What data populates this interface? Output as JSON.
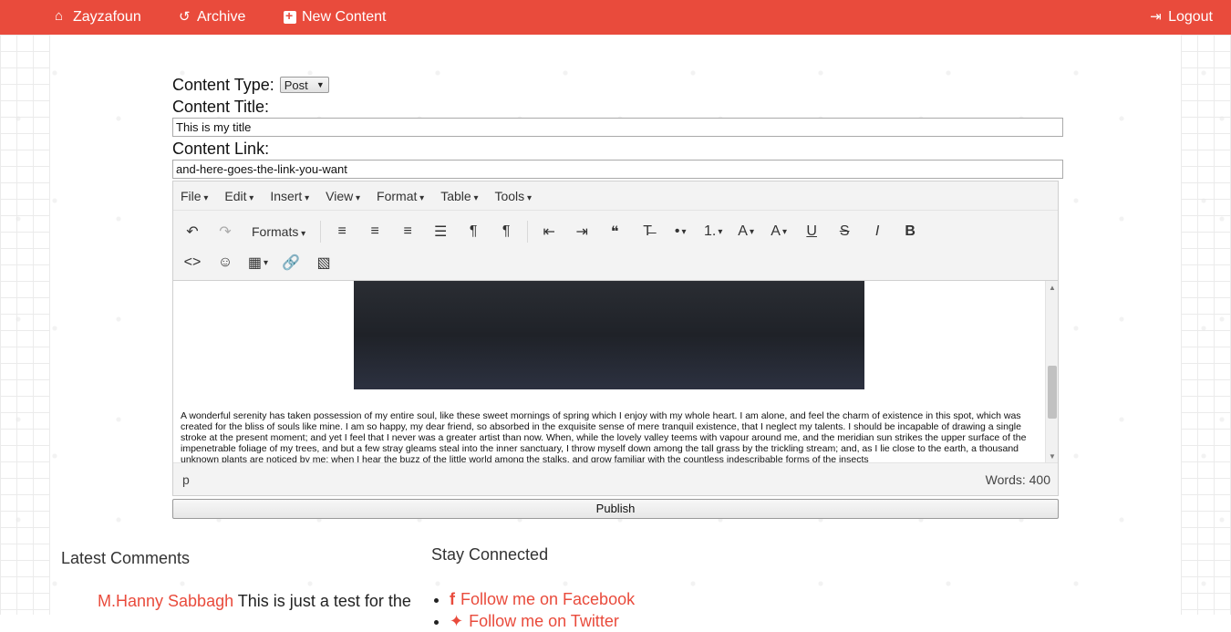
{
  "nav": {
    "items": [
      {
        "label": "Zayzafoun"
      },
      {
        "label": "Archive"
      },
      {
        "label": "New Content"
      }
    ],
    "logout_label": "Logout",
    "bg_color": "#e94b3c"
  },
  "form": {
    "content_type_label": "Content Type:",
    "content_type_value": "Post",
    "content_title_label": "Content Title:",
    "content_title_value": "This is my title",
    "content_link_label": "Content Link:",
    "content_link_value": "and-here-goes-the-link-you-want"
  },
  "editor": {
    "menus": [
      "File",
      "Edit",
      "Insert",
      "View",
      "Format",
      "Table",
      "Tools"
    ],
    "formats_label": "Formats",
    "paragraph_text": "A wonderful serenity has taken possession of my entire soul, like these sweet mornings of spring which I enjoy with my whole heart. I am alone, and feel the charm of existence in this spot, which was created for the bliss of souls like mine. I am so happy, my dear friend, so absorbed in the exquisite sense of mere tranquil existence, that I neglect my talents. I should be incapable of drawing a single stroke at the present moment; and yet I feel that I never was a greater artist than now. When, while the lovely valley teems with vapour around me, and the meridian sun strikes the upper surface of the impenetrable foliage of my trees, and but a few stray gleams steal into the inner sanctuary, I throw myself down among the tall grass by the trickling stream; and, as I lie close to the earth, a thousand unknown plants are noticed by me: when I hear the buzz of the little world among the stalks, and grow familiar with the countless indescribable forms of the insects",
    "status_path": "p",
    "word_count": "Words: 400"
  },
  "publish_label": "Publish",
  "latest_comments": {
    "heading": "Latest Comments",
    "author": "M.Hanny Sabbagh",
    "text": "This is just a test for the"
  },
  "stay_connected": {
    "heading": "Stay Connected",
    "links": [
      {
        "label": "Follow me on Facebook"
      },
      {
        "label": "Follow me on Twitter"
      }
    ]
  }
}
